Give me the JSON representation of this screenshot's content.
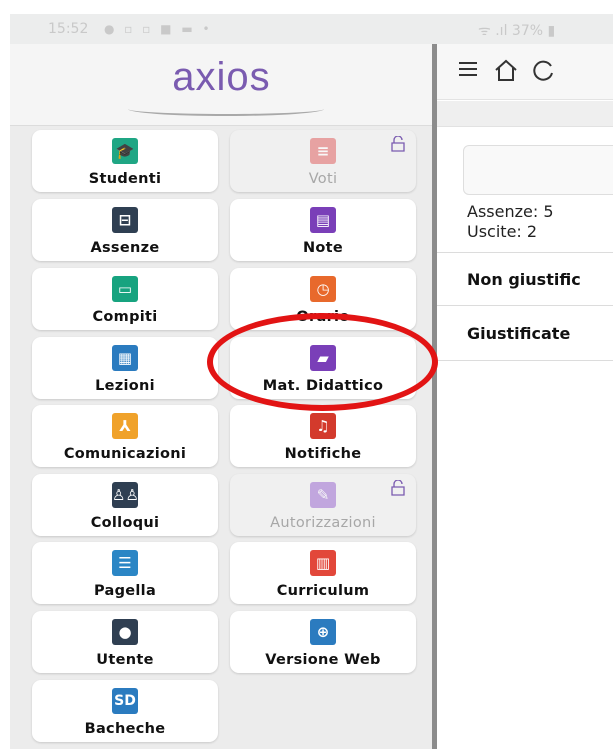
{
  "status_bar": {
    "time": "15:52",
    "battery": "37%"
  },
  "app": {
    "logo_text": "axios"
  },
  "menu": {
    "tiles": [
      {
        "label": "Studenti",
        "icon": "graduation-cap-icon",
        "color": "#1fa684"
      },
      {
        "label": "Voti",
        "icon": "grades-icon",
        "color": "#e06464",
        "locked": true
      },
      {
        "label": "Assenze",
        "icon": "bed-icon",
        "color": "#2f3f52"
      },
      {
        "label": "Note",
        "icon": "note-icon",
        "color": "#7a3fb8"
      },
      {
        "label": "Compiti",
        "icon": "blackboard-icon",
        "color": "#17a37f"
      },
      {
        "label": "Orario",
        "icon": "clock-icon",
        "color": "#e8692c"
      },
      {
        "label": "Lezioni",
        "icon": "lesson-icon",
        "color": "#2b7bbf"
      },
      {
        "label": "Mat. Didattico",
        "icon": "books-icon",
        "color": "#7a3fb8"
      },
      {
        "label": "Comunicazioni",
        "icon": "pdf-icon",
        "color": "#f0a22a"
      },
      {
        "label": "Notifiche",
        "icon": "bell-icon",
        "color": "#d33a2c"
      },
      {
        "label": "Colloqui",
        "icon": "people-icon",
        "color": "#2f3f52"
      },
      {
        "label": "Autorizzazioni",
        "icon": "signature-icon",
        "color": "#9b6ad0",
        "locked": true
      },
      {
        "label": "Pagella",
        "icon": "report-card-icon",
        "color": "#2b86c5"
      },
      {
        "label": "Curriculum",
        "icon": "certificate-icon",
        "color": "#e2473a"
      },
      {
        "label": "Utente",
        "icon": "user-icon",
        "color": "#2f3f52"
      },
      {
        "label": "Versione Web",
        "icon": "globe-icon",
        "color": "#2b7bbf"
      },
      {
        "label": "Bacheche",
        "icon": "sd-board-icon",
        "color": "#2b7bbf",
        "icon_text": "SD"
      }
    ]
  },
  "main": {
    "stats": {
      "assenze": "Assenze: 5",
      "uscite": "Uscite: 2"
    },
    "rows": [
      "Non giustific",
      "Giustificate"
    ]
  }
}
